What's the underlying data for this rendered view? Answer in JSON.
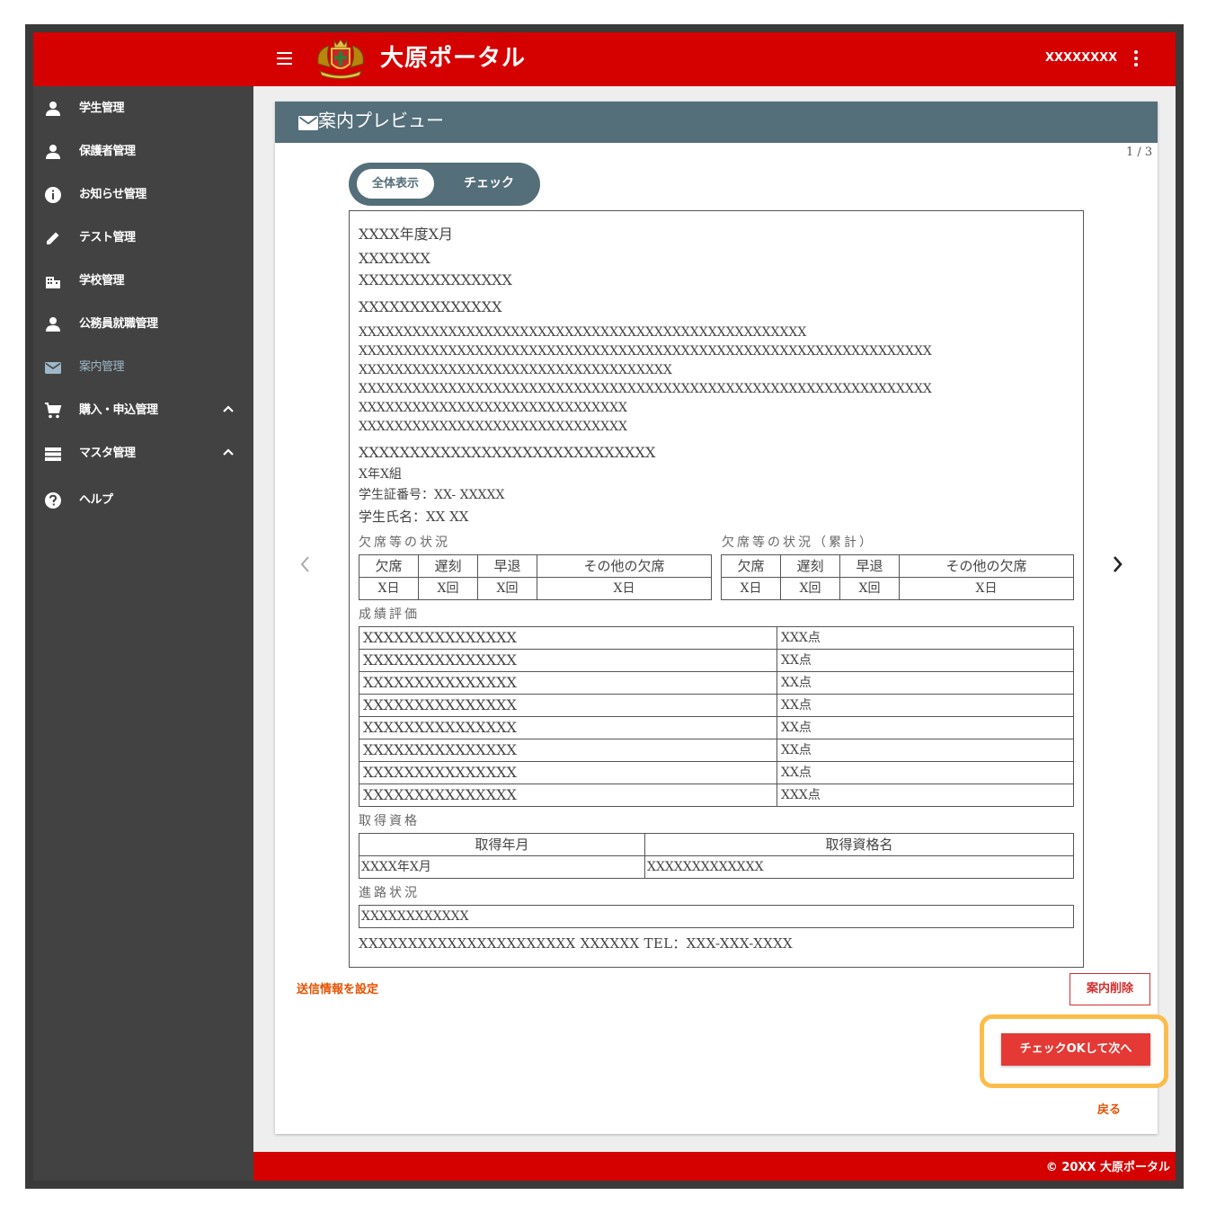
{
  "header": {
    "title": "大原ポータル",
    "user": "XXXXXXXX"
  },
  "sidebar": {
    "items": [
      {
        "label": "学生管理",
        "icon": "person-icon"
      },
      {
        "label": "保護者管理",
        "icon": "person-icon"
      },
      {
        "label": "お知らせ管理",
        "icon": "info-icon"
      },
      {
        "label": "テスト管理",
        "icon": "pencil-icon"
      },
      {
        "label": "学校管理",
        "icon": "building-icon"
      },
      {
        "label": "公務員就職管理",
        "icon": "person-icon"
      },
      {
        "label": "案内管理",
        "icon": "mail-icon",
        "active": true
      },
      {
        "label": "購入・申込管理",
        "icon": "cart-icon"
      },
      {
        "label": "マスタ管理",
        "icon": "list-icon"
      },
      {
        "label": "ヘルプ",
        "icon": "help-icon"
      }
    ]
  },
  "card": {
    "title": "案内プレビュー",
    "page_indicator": "1 / 3",
    "toggle": {
      "all": "全体表示",
      "check": "チェック"
    }
  },
  "doc": {
    "line1": "XXXX年度X月",
    "line2": "XXXXXXX",
    "line3": "XXXXXXXXXXXXXXX",
    "line4": "XXXXXXXXXXXXXX",
    "body": [
      "XXXXXXXXXXXXXXXXXXXXXXXXXXXXXXXXXXXXXXXXXXXXXXXXXX",
      "XXXXXXXXXXXXXXXXXXXXXXXXXXXXXXXXXXXXXXXXXXXXXXXXXXXXXXXXXXXXXXXX",
      "XXXXXXXXXXXXXXXXXXXXXXXXXXXXXXXXXXX",
      "XXXXXXXXXXXXXXXXXXXXXXXXXXXXXXXXXXXXXXXXXXXXXXXXXXXXXXXXXXXXXXXX",
      "XXXXXXXXXXXXXXXXXXXXXXXXXXXXXX",
      "XXXXXXXXXXXXXXXXXXXXXXXXXXXXXX"
    ],
    "school": "XXXXXXXXXXXXXXXXXXXXXXXXXXXXX",
    "class": "X年X組",
    "student_no": "学生証番号：XX- XXXXX",
    "student_name": "学生氏名：XX XX",
    "absence_title": "欠席等の状況",
    "absence_total_title": "欠席等の状況（累計）",
    "absence_headers": [
      "欠席",
      "遅刻",
      "早退",
      "その他の欠席"
    ],
    "absence_values": [
      "X日",
      "X回",
      "X回",
      "X日"
    ],
    "absence_total_values": [
      "X日",
      "X回",
      "X回",
      "X日"
    ],
    "grades_title": "成績評価",
    "grades": [
      {
        "name": "XXXXXXXXXXXXXXX",
        "score": "XXX点"
      },
      {
        "name": "XXXXXXXXXXXXXXX",
        "score": "XX点"
      },
      {
        "name": "XXXXXXXXXXXXXXX",
        "score": "XX点"
      },
      {
        "name": "XXXXXXXXXXXXXXX",
        "score": "XX点"
      },
      {
        "name": "XXXXXXXXXXXXXXX",
        "score": "XX点"
      },
      {
        "name": "XXXXXXXXXXXXXXX",
        "score": "XX点"
      },
      {
        "name": "XXXXXXXXXXXXXXX",
        "score": "XX点"
      },
      {
        "name": "XXXXXXXXXXXXXXX",
        "score": "XXX点"
      }
    ],
    "qual_title": "取得資格",
    "qual_headers": [
      "取得年月",
      "取得資格名"
    ],
    "qual_row": [
      "XXXX年X月",
      "XXXXXXXXXXXXX"
    ],
    "career_title": "進路状況",
    "career_value": "XXXXXXXXXXXX",
    "contact_line": "XXXXXXXXXXXXXXXXXXXXXX XXXXXX TEL：XXX-XXX-XXXX"
  },
  "actions": {
    "send_settings": "送信情報を設定",
    "delete": "案内削除",
    "check_ok": "チェックOKして次へ",
    "back": "戻る"
  },
  "footer": {
    "copyright": "© 20XX 大原ポータル"
  },
  "colors": {
    "header": "#d50000",
    "sidebar": "#424242",
    "card_head": "#546e7a",
    "highlight": "#fbbd4a",
    "primary_button": "#e53935",
    "link": "#e65100"
  }
}
